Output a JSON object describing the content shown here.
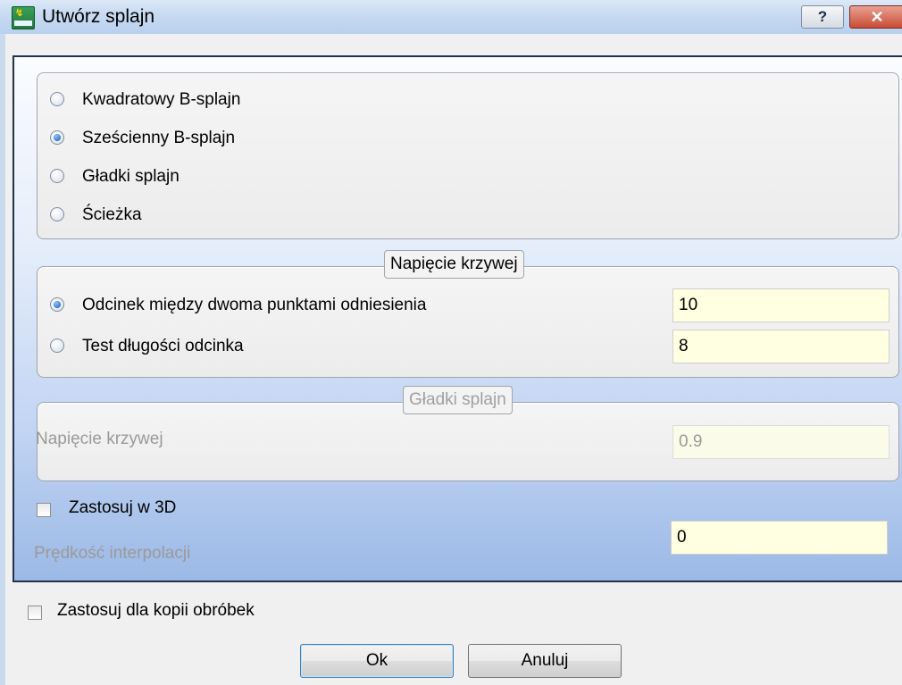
{
  "window": {
    "title": "Utwórz splajn",
    "help_label": "?",
    "close_label": "✕"
  },
  "spline_type": {
    "options": [
      {
        "label": "Kwadratowy B-splajn",
        "checked": false
      },
      {
        "label": "Sześcienny B-splajn",
        "checked": true
      },
      {
        "label": "Gładki splajn",
        "checked": false
      },
      {
        "label": "Ścieżka",
        "checked": false
      }
    ]
  },
  "tension_group": {
    "legend": "Napięcie krzywej",
    "option1_label": "Odcinek między dwoma punktami odniesienia",
    "option1_value": "10",
    "option2_label": "Test długości odcinka",
    "option2_value": "8"
  },
  "smooth_group": {
    "legend": "Gładki splajn",
    "label": "Napięcie krzywej",
    "value": "0.9"
  },
  "apply_3d": {
    "label": "Zastosuj w 3D",
    "checked": false
  },
  "interpolation": {
    "label": "Prędkość interpolacji",
    "value": "0"
  },
  "apply_copies": {
    "label": "Zastosuj dla kopii obróbek",
    "checked": false
  },
  "buttons": {
    "ok": "Ok",
    "cancel": "Anuluj"
  }
}
